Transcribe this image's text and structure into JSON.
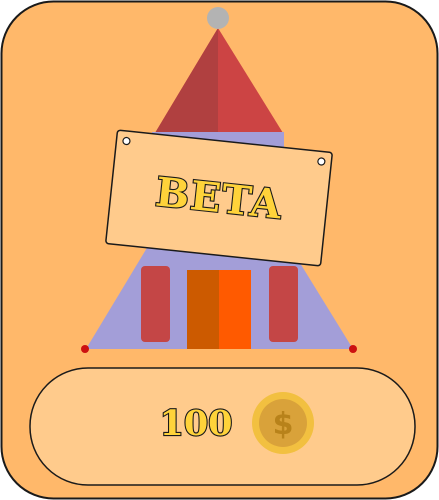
{
  "item": {
    "name": "Tower",
    "badge_label": "BETA",
    "price": "100",
    "currency_icon": "dollar-coin-icon",
    "currency_symbol": "$"
  },
  "colors": {
    "card_background": "#ffb86a",
    "price_pill": "#ffcb8c",
    "roof_red": "#cc4444",
    "roof_dark": "#b04040",
    "tower_purple": "#a39ed8",
    "door_orange": "#ff5a00",
    "door_dark": "#cc5a00",
    "sign_background": "#ffcb8c",
    "coin_gold": "#d9a23a",
    "label_fill": "#ffd33a"
  }
}
